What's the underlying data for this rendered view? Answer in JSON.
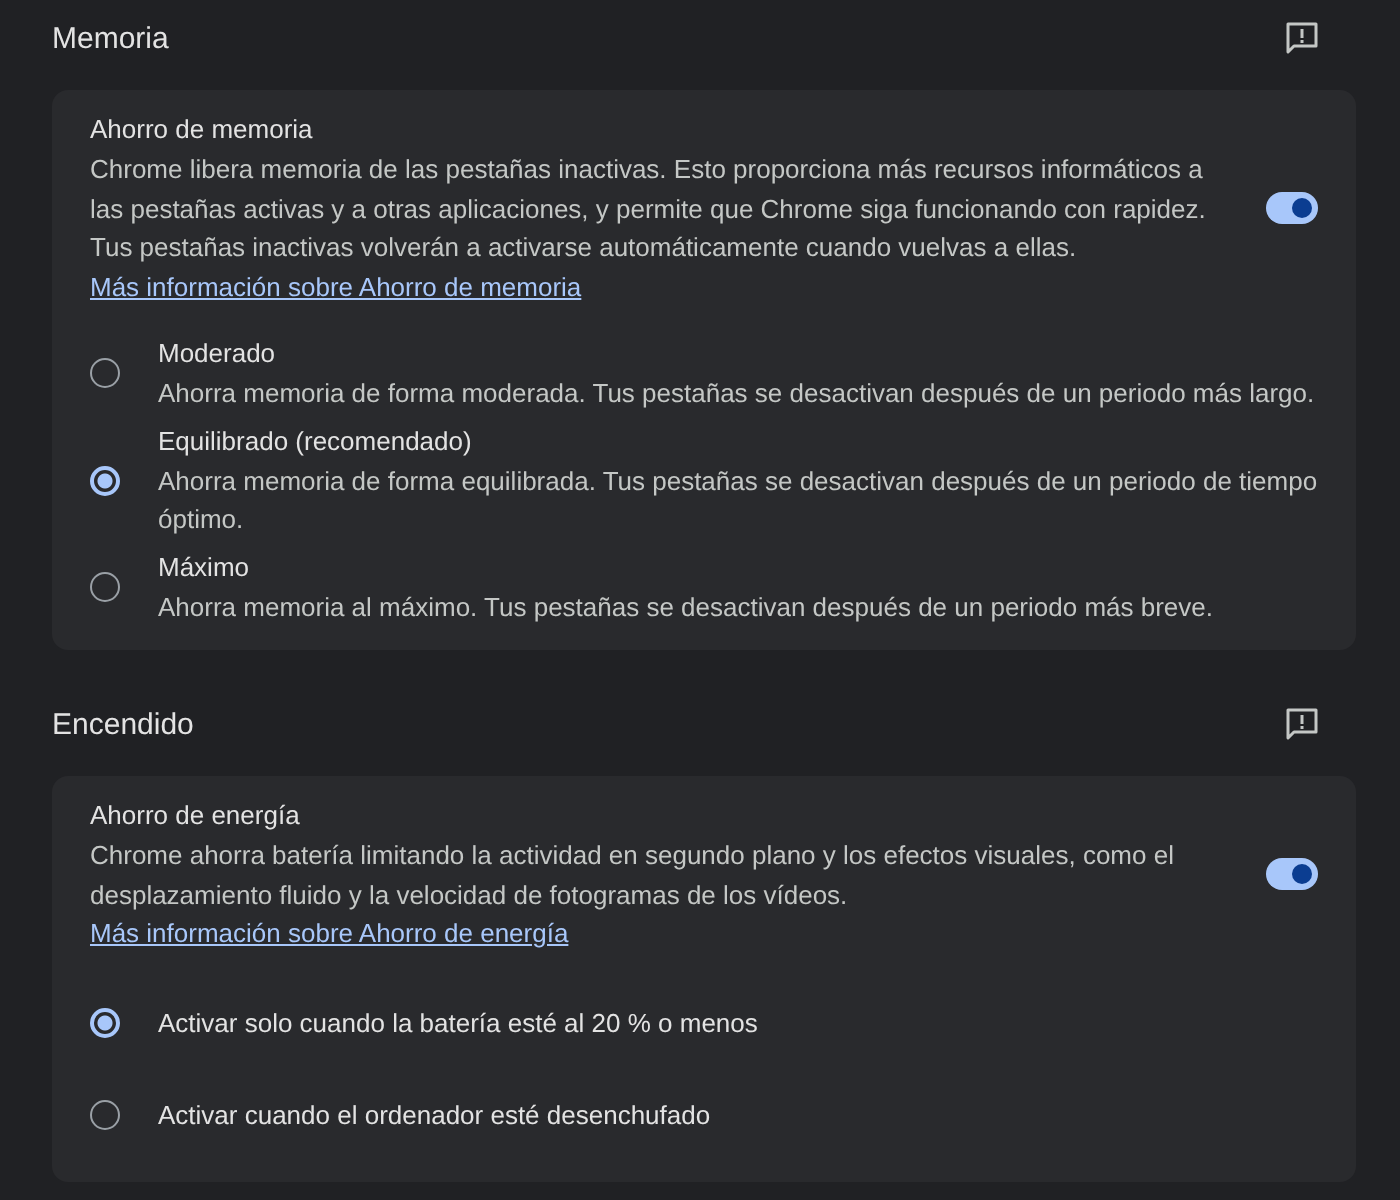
{
  "sections": [
    {
      "title": "Memoria",
      "setting": {
        "title": "Ahorro de memoria",
        "description": "Chrome libera memoria de las pestañas inactivas. Esto proporciona más recursos informáticos a las pestañas activas y a otras aplicaciones, y permite que Chrome siga funcionando con rapidez. Tus pestañas inactivas volverán a activarse automáticamente cuando vuelvas a ellas.",
        "link": "Más información sobre Ahorro de memoria",
        "on": true
      },
      "options": [
        {
          "label": "Moderado",
          "description": "Ahorra memoria de forma moderada. Tus pestañas se desactivan después de un periodo más largo.",
          "selected": false
        },
        {
          "label": "Equilibrado (recomendado)",
          "description": "Ahorra memoria de forma equilibrada. Tus pestañas se desactivan después de un periodo de tiempo óptimo.",
          "selected": true
        },
        {
          "label": "Máximo",
          "description": "Ahorra memoria al máximo. Tus pestañas se desactivan después de un periodo más breve.",
          "selected": false
        }
      ]
    },
    {
      "title": "Encendido",
      "setting": {
        "title": "Ahorro de energía",
        "description": "Chrome ahorra batería limitando la actividad en segundo plano y los efectos visuales, como el desplazamiento fluido y la velocidad de fotogramas de los vídeos.",
        "link": "Más información sobre Ahorro de energía",
        "on": true
      },
      "options": [
        {
          "label": "Activar solo cuando la batería esté al 20 % o menos",
          "selected": true
        },
        {
          "label": "Activar cuando el ordenador esté desenchufado",
          "selected": false
        }
      ]
    }
  ]
}
